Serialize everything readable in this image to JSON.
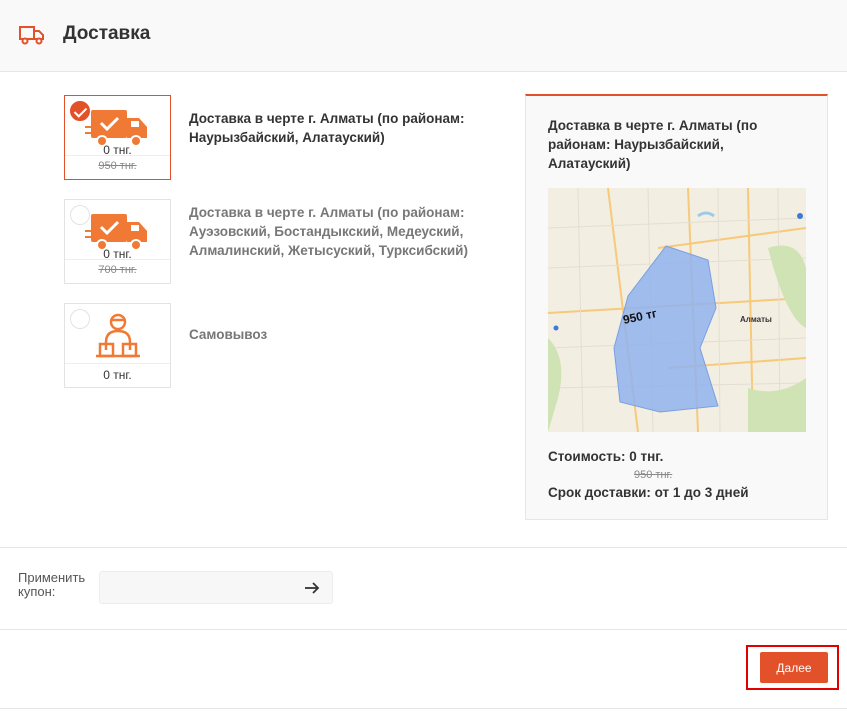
{
  "header": {
    "title": "Доставка",
    "icon": "truck-icon"
  },
  "options": [
    {
      "title": "Доставка в черте г. Алматы (по районам: Наурызбайский, Алатауский)",
      "price": "0 тнг.",
      "old_price": "950 тнг.",
      "icon": "delivery-truck-icon",
      "selected": true
    },
    {
      "title": "Доставка в черте г. Алматы (по районам: Ауэзовский, Бостандыкский, Медеуский, Алмалинский, Жетысуский, Турксибский)",
      "price": "0 тнг.",
      "old_price": "700 тнг.",
      "icon": "delivery-truck-icon",
      "selected": false
    },
    {
      "title": "Самовывоз",
      "price": "0 тнг.",
      "icon": "courier-boxes-icon",
      "selected": false
    }
  ],
  "info": {
    "title": "Доставка в черте г. Алматы (по районам: Наурызбайский, Алатауский)",
    "map_label": "950 тг",
    "city_label": "Алматы",
    "cost": "Стоимость: 0 тнг.",
    "old_cost": "950 тнг.",
    "term": "Срок доставки: от 1 до 3 дней"
  },
  "coupon": {
    "label": "Применить купон:",
    "value": "",
    "placeholder": "",
    "submit_icon": "arrow-right-icon"
  },
  "next_button": {
    "label": "Далее"
  },
  "colors": {
    "accent": "#e2512a",
    "highlight": "#e00000",
    "zone": "#8fb3ee"
  }
}
